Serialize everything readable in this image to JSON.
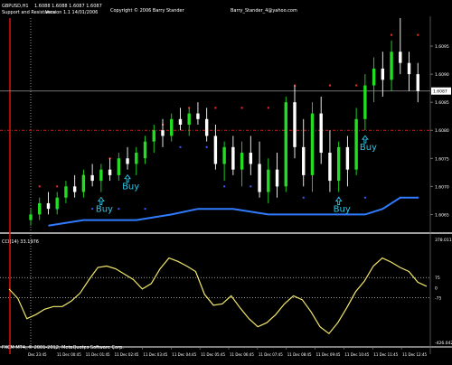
{
  "window": {
    "header_symbol": "GBPUSD,H1",
    "header_ohlc": "1.6088 1.6088 1.6087 1.6087",
    "indicator_name": "Support and Resistance",
    "indicator_version": "Version 1.1  14/01/2006",
    "copyright": "Copyright © 2006 Barry Stander",
    "email": "Barry_Stander_4@yahoo.com",
    "footer": "FXCM MT4, © 2001-2012, MetaQuotes Software Corp."
  },
  "colors": {
    "background": "#000000",
    "bull_candle": "#22dd22",
    "bear_candle": "#ffffff",
    "resistance_dots": "#ff2a2a",
    "support_dots": "#3a5cff",
    "support_line": "#2f7cff",
    "cci_line": "#f2e86a",
    "signal_text": "#2fc6e6",
    "price_line": "#999999",
    "red_hline": "#cc2222",
    "red_vline": "#dd1111"
  },
  "chart_data": [
    {
      "type": "candlestick",
      "price_axis_ticks": [
        "1.6095",
        "1.6090",
        "1.6085",
        "1.6080",
        "1.6075",
        "1.6070",
        "1.6065"
      ],
      "current_price_label": "1.6087",
      "ylim": [
        1.6062,
        1.61
      ],
      "candles": [
        [
          1.6064,
          1.6066,
          1.6063,
          1.6065
        ],
        [
          1.6065,
          1.6068,
          1.6064,
          1.6067
        ],
        [
          1.6067,
          1.6069,
          1.6065,
          1.6066
        ],
        [
          1.6066,
          1.6069,
          1.6065,
          1.6068
        ],
        [
          1.6068,
          1.6071,
          1.6067,
          1.607
        ],
        [
          1.607,
          1.6072,
          1.6068,
          1.6069
        ],
        [
          1.6069,
          1.6073,
          1.6068,
          1.6072
        ],
        [
          1.6072,
          1.6074,
          1.607,
          1.6071
        ],
        [
          1.6071,
          1.6074,
          1.6069,
          1.6073
        ],
        [
          1.6073,
          1.6075,
          1.6071,
          1.6072
        ],
        [
          1.6072,
          1.6076,
          1.6071,
          1.6075
        ],
        [
          1.6075,
          1.6077,
          1.6073,
          1.6074
        ],
        [
          1.6074,
          1.6077,
          1.6072,
          1.6076
        ],
        [
          1.6075,
          1.6079,
          1.6074,
          1.6078
        ],
        [
          1.6078,
          1.6081,
          1.6076,
          1.608
        ],
        [
          1.608,
          1.6082,
          1.6077,
          1.6079
        ],
        [
          1.6079,
          1.6083,
          1.6078,
          1.6082
        ],
        [
          1.6082,
          1.6084,
          1.608,
          1.6081
        ],
        [
          1.6081,
          1.6084,
          1.6079,
          1.6083
        ],
        [
          1.6083,
          1.6085,
          1.6081,
          1.6082
        ],
        [
          1.6082,
          1.6084,
          1.6078,
          1.6079
        ],
        [
          1.6079,
          1.6081,
          1.6073,
          1.6074
        ],
        [
          1.6074,
          1.6078,
          1.6071,
          1.6077
        ],
        [
          1.6077,
          1.6079,
          1.6072,
          1.6073
        ],
        [
          1.6073,
          1.6078,
          1.607,
          1.6076
        ],
        [
          1.6076,
          1.6079,
          1.6072,
          1.6074
        ],
        [
          1.6074,
          1.6078,
          1.6068,
          1.6069
        ],
        [
          1.6069,
          1.6075,
          1.6067,
          1.6073
        ],
        [
          1.6073,
          1.6076,
          1.6068,
          1.607
        ],
        [
          1.607,
          1.6086,
          1.6069,
          1.6085
        ],
        [
          1.6085,
          1.6088,
          1.6075,
          1.6077
        ],
        [
          1.6077,
          1.6082,
          1.607,
          1.6072
        ],
        [
          1.6072,
          1.6085,
          1.6069,
          1.6083
        ],
        [
          1.6083,
          1.6086,
          1.6074,
          1.6076
        ],
        [
          1.6076,
          1.608,
          1.6069,
          1.6071
        ],
        [
          1.6071,
          1.6078,
          1.6069,
          1.6077
        ],
        [
          1.6077,
          1.6079,
          1.607,
          1.6073
        ],
        [
          1.6073,
          1.6084,
          1.6072,
          1.6082
        ],
        [
          1.6082,
          1.609,
          1.608,
          1.6088
        ],
        [
          1.6088,
          1.6093,
          1.6085,
          1.6091
        ],
        [
          1.6091,
          1.6094,
          1.6086,
          1.6089
        ],
        [
          1.6089,
          1.6096,
          1.6087,
          1.6094
        ],
        [
          1.6094,
          1.61,
          1.609,
          1.6092
        ],
        [
          1.6092,
          1.6094,
          1.6087,
          1.609
        ],
        [
          1.609,
          1.6092,
          1.6085,
          1.6087
        ]
      ],
      "resistance": [
        [
          1,
          1.607
        ],
        [
          3,
          1.607
        ],
        [
          6,
          1.6072
        ],
        [
          9,
          1.6075
        ],
        [
          12,
          1.6075
        ],
        [
          15,
          1.6081
        ],
        [
          18,
          1.6084
        ],
        [
          21,
          1.6084
        ],
        [
          24,
          1.6084
        ],
        [
          27,
          1.6084
        ],
        [
          30,
          1.6088
        ],
        [
          34,
          1.6088
        ],
        [
          37,
          1.6088
        ],
        [
          39,
          1.6089
        ],
        [
          41,
          1.6097
        ],
        [
          44,
          1.6097
        ]
      ],
      "support": [
        [
          1,
          1.6066
        ],
        [
          3,
          1.6066
        ],
        [
          7,
          1.6066
        ],
        [
          10,
          1.6066
        ],
        [
          13,
          1.6066
        ],
        [
          17,
          1.6077
        ],
        [
          20,
          1.6077
        ],
        [
          22,
          1.607
        ],
        [
          25,
          1.607
        ],
        [
          28,
          1.607
        ],
        [
          31,
          1.6068
        ],
        [
          35,
          1.6068
        ],
        [
          38,
          1.6068
        ],
        [
          42,
          1.6068
        ],
        [
          44,
          1.6068
        ]
      ],
      "support_line": [
        [
          2,
          1.6063
        ],
        [
          6,
          1.6064
        ],
        [
          12,
          1.6064
        ],
        [
          16,
          1.6065
        ],
        [
          19,
          1.6066
        ],
        [
          23,
          1.6066
        ],
        [
          27,
          1.6065
        ],
        [
          33,
          1.6065
        ],
        [
          38,
          1.6065
        ],
        [
          40,
          1.6066
        ],
        [
          42,
          1.6068
        ],
        [
          44,
          1.6068
        ]
      ],
      "signals": [
        {
          "label": "Buy",
          "index": 8
        },
        {
          "label": "Buy",
          "index": 11
        },
        {
          "label": "Buy",
          "index": 35
        },
        {
          "label": "Buy",
          "index": 38
        }
      ]
    },
    {
      "type": "line",
      "name": "CCI(14) 33.1976",
      "axis_ticks": [
        "378.0117",
        "75",
        "0",
        "-75",
        "-426.0427"
      ],
      "ylim": [
        -426.0427,
        378.0117
      ],
      "levels": [
        75,
        -75
      ],
      "values": [
        -10,
        -80,
        -230,
        -200,
        -160,
        -140,
        -140,
        -100,
        -40,
        60,
        150,
        160,
        140,
        100,
        60,
        -10,
        30,
        140,
        220,
        195,
        160,
        120,
        -50,
        -130,
        -120,
        -60,
        -150,
        -230,
        -290,
        -260,
        -200,
        -120,
        -60,
        -90,
        -180,
        -290,
        -340,
        -260,
        -150,
        -30,
        50,
        160,
        220,
        190,
        150,
        120,
        40,
        10
      ]
    }
  ],
  "time_axis": [
    "Dec 23:45",
    "11 Dec 00:45",
    "11 Dec 01:45",
    "11 Dec 02:45",
    "11 Dec 03:45",
    "11 Dec 04:45",
    "11 Dec 05:45",
    "11 Dec 06:45",
    "11 Dec 07:45",
    "11 Dec 08:45",
    "11 Dec 09:45",
    "11 Dec 10:45",
    "11 Dec 11:45",
    "11 Dec 12:45"
  ]
}
